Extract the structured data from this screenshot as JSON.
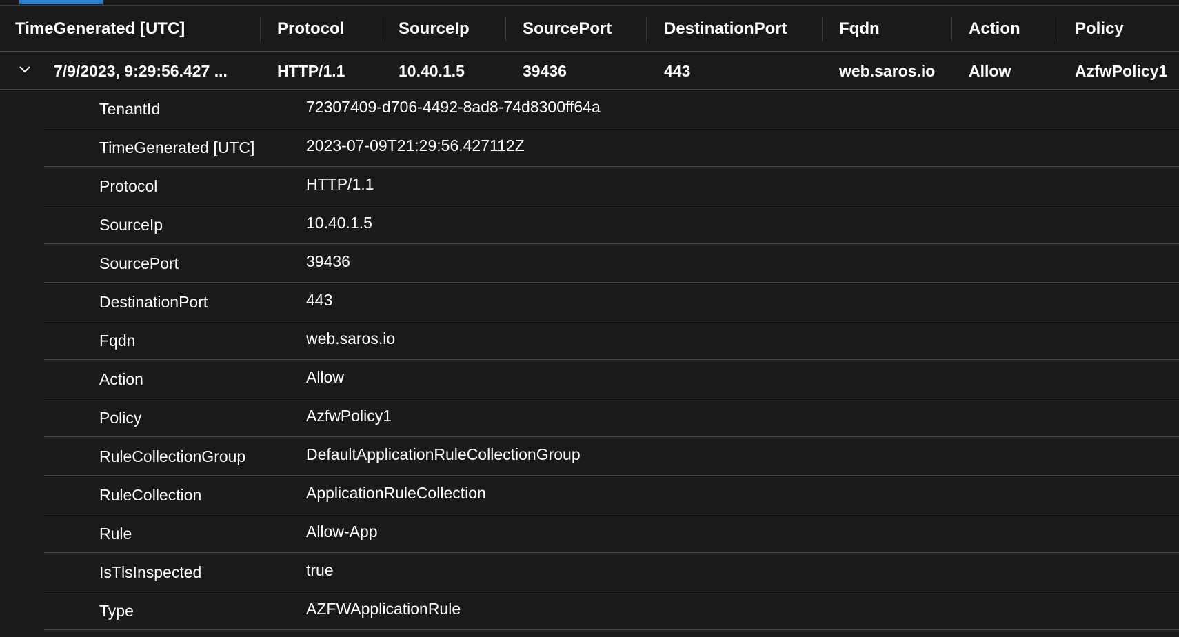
{
  "columns": [
    "TimeGenerated [UTC]",
    "Protocol",
    "SourceIp",
    "SourcePort",
    "DestinationPort",
    "Fqdn",
    "Action",
    "Policy"
  ],
  "row": {
    "time": "7/9/2023, 9:29:56.427 ...",
    "protocol": "HTTP/1.1",
    "source_ip": "10.40.1.5",
    "source_port": "39436",
    "destination_port": "443",
    "fqdn": "web.saros.io",
    "action": "Allow",
    "policy": "AzfwPolicy1",
    "expanded": true
  },
  "details": [
    {
      "key": "TenantId",
      "value": "72307409-d706-4492-8ad8-74d8300ff64a"
    },
    {
      "key": "TimeGenerated [UTC]",
      "value": "2023-07-09T21:29:56.427112Z"
    },
    {
      "key": "Protocol",
      "value": "HTTP/1.1"
    },
    {
      "key": "SourceIp",
      "value": "10.40.1.5"
    },
    {
      "key": "SourcePort",
      "value": "39436"
    },
    {
      "key": "DestinationPort",
      "value": "443"
    },
    {
      "key": "Fqdn",
      "value": "web.saros.io"
    },
    {
      "key": "Action",
      "value": "Allow"
    },
    {
      "key": "Policy",
      "value": "AzfwPolicy1"
    },
    {
      "key": "RuleCollectionGroup",
      "value": "DefaultApplicationRuleCollectionGroup"
    },
    {
      "key": "RuleCollection",
      "value": "ApplicationRuleCollection"
    },
    {
      "key": "Rule",
      "value": "Allow-App"
    },
    {
      "key": "IsTlsInspected",
      "value": "true"
    },
    {
      "key": "Type",
      "value": "AZFWApplicationRule"
    }
  ],
  "icons": {
    "expand": "chevron-down-icon"
  },
  "colors": {
    "background": "#1b1a19",
    "text": "#ffffff",
    "divider": "#4a4a4a",
    "active_tab": "#2f7fd1"
  }
}
